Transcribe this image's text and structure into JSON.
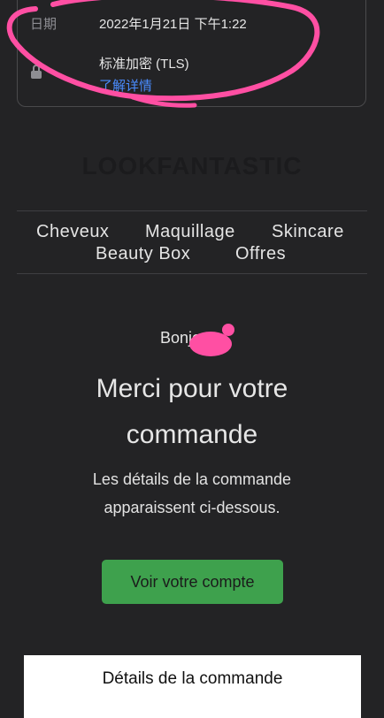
{
  "header": {
    "date_label": "日期",
    "date_value": "2022年1月21日 下午1:22",
    "encryption": "标准加密 (TLS)",
    "learn_more": "了解详情"
  },
  "brand": {
    "logo": "LOOKFANTASTIC"
  },
  "nav": {
    "items": [
      "Cheveux",
      "Maquillage",
      "Skincare",
      "Beauty Box",
      "Offres"
    ]
  },
  "email": {
    "greeting": "Bonjour  ,",
    "title_line1": "Merci pour votre",
    "title_line2": "commande",
    "subtitle_line1": "Les détails de la commande",
    "subtitle_line2": "apparaissent ci-dessous.",
    "cta_label": "Voir votre compte",
    "details_heading": "Détails de la commande"
  },
  "colors": {
    "background": "#232325",
    "accent_button": "#3ea14d",
    "link": "#4a8cff",
    "annotation": "#ff4fa3"
  },
  "icons": {
    "lock": "lock-icon"
  }
}
